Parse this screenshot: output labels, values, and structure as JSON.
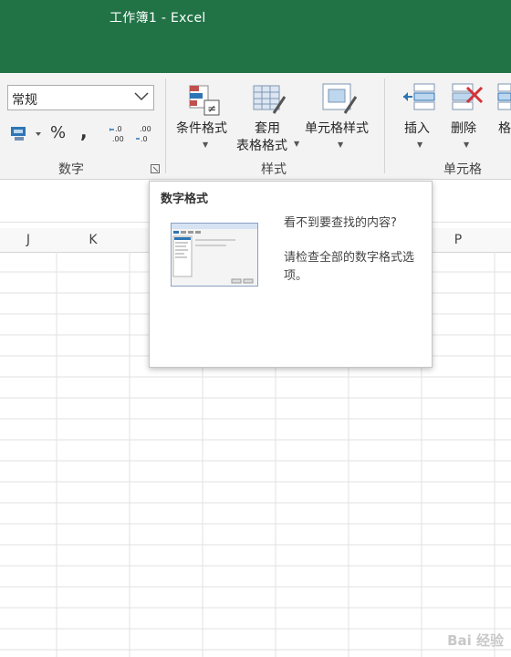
{
  "window": {
    "title": "工作簿1  -  Excel"
  },
  "ribbon": {
    "number_group": {
      "format_value": "常规",
      "percent": "%",
      "comma": ",",
      "label": "数字"
    },
    "styles_group": {
      "conditional_format": "条件格式",
      "table_format_line1": "套用",
      "table_format_line2": "表格格式",
      "cell_styles": "单元格样式",
      "label": "样式"
    },
    "cells_group": {
      "insert": "插入",
      "delete": "删除",
      "format_partial": "格",
      "label": "单元格"
    }
  },
  "columns": [
    "J",
    "K",
    "P"
  ],
  "tooltip": {
    "title": "数字格式",
    "question": "看不到要查找的内容?",
    "body": "请检查全部的数字格式选项。"
  },
  "watermark": "Bai 经验",
  "colors": {
    "title_bar": "#217346",
    "ribbon_bg": "#f3f3f3",
    "grid_line": "#e2e2e2"
  }
}
